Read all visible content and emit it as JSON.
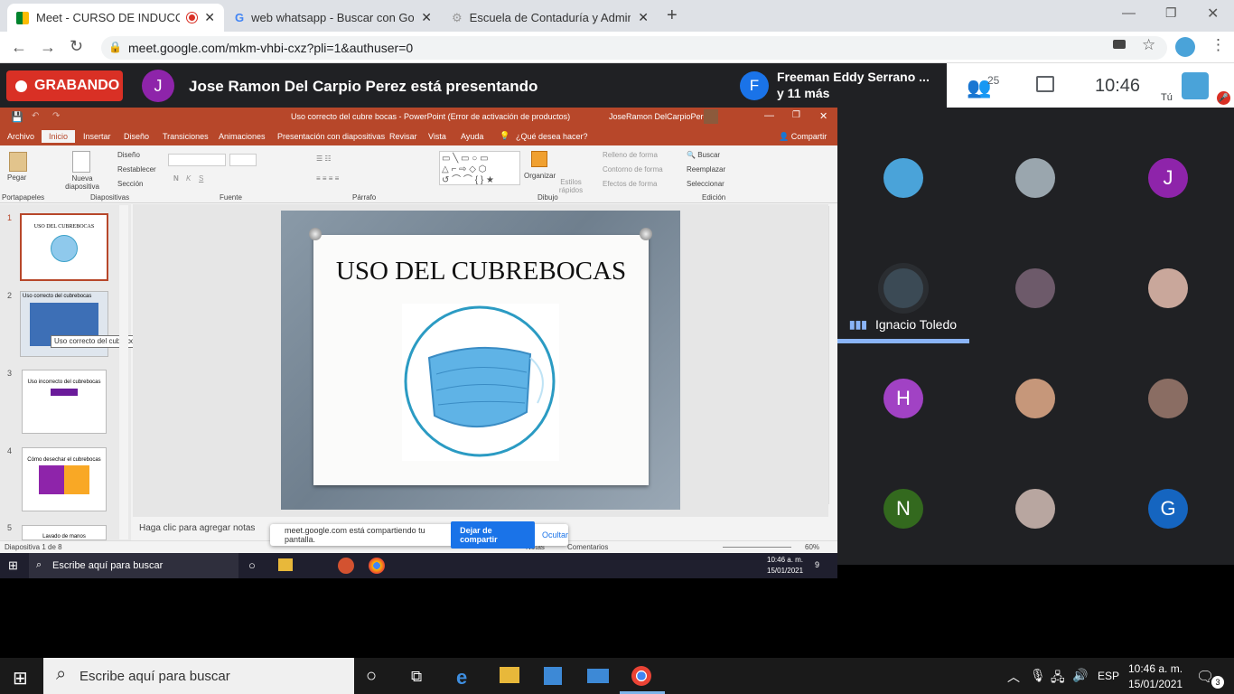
{
  "browser": {
    "tabs": [
      {
        "title": "Meet - CURSO DE INDUCCIÓ",
        "favicon": "meet-icon"
      },
      {
        "title": "web whatsapp - Buscar con Goo",
        "favicon": "google-icon"
      },
      {
        "title": "Escuela de Contaduría y Adminis",
        "favicon": "school-icon"
      }
    ],
    "url": "meet.google.com/mkm-vhbi-cxz?pli=1&authuser=0"
  },
  "meet": {
    "recording_label": "GRABANDO",
    "presenter_initial": "J",
    "presenter_text": "Jose Ramon Del Carpio Perez está presentando",
    "other_initial": "F",
    "other_line1": "Freeman Eddy Serrano ...",
    "other_line2": "y 11 más",
    "participant_count": "25",
    "time": "10:46",
    "self_label": "Tú",
    "speaking_name": "Ignacio Toledo",
    "tiles": [
      {
        "initial": "",
        "color": "#4aa3d9"
      },
      {
        "initial": "",
        "color": "#9aa6ae"
      },
      {
        "initial": "J",
        "color": "#8e24aa"
      },
      {
        "initial": "",
        "color": "#3b4a55"
      },
      {
        "initial": "",
        "color": "#6d5a6a"
      },
      {
        "initial": "",
        "color": "#c9a79b"
      },
      {
        "initial": "H",
        "color": "#a142c4"
      },
      {
        "initial": "",
        "color": "#c6977a"
      },
      {
        "initial": "",
        "color": "#8a6d63"
      },
      {
        "initial": "N",
        "color": "#33691e"
      },
      {
        "initial": "",
        "color": "#b8a6a0"
      },
      {
        "initial": "G",
        "color": "#1565c0"
      }
    ]
  },
  "ppt": {
    "title": "Uso correcto del cubre bocas  -  PowerPoint (Error de activación de productos)",
    "user": "JoseRamon DelCarpioPerez",
    "tabs": [
      "Archivo",
      "Inicio",
      "Insertar",
      "Diseño",
      "Transiciones",
      "Animaciones",
      "Presentación con diapositivas",
      "Revisar",
      "Vista",
      "Ayuda",
      "¿Qué desea hacer?"
    ],
    "share": "Compartir",
    "groups": [
      "Portapapeles",
      "Diapositivas",
      "Fuente",
      "Párrafo",
      "Dibujo",
      "Edición"
    ],
    "clip": {
      "paste": "Pegar"
    },
    "slides_group": {
      "new": "Nueva diapositiva",
      "layout": "Diseño",
      "reset": "Restablecer",
      "section": "Sección"
    },
    "drawing": {
      "arrange": "Organizar",
      "styles": "Estilos rápidos",
      "fill": "Relleno de forma",
      "outline": "Contorno de forma",
      "effects": "Efectos de forma"
    },
    "editing": {
      "find": "Buscar",
      "replace": "Reemplazar",
      "select": "Seleccionar"
    },
    "thumbs": [
      {
        "num": "1",
        "text": "USO DEL CUBREBOCAS"
      },
      {
        "num": "2",
        "text": "Uso correcto del cubrebocas"
      },
      {
        "num": "3",
        "text": "Uso incorrecto del cubrebocas"
      },
      {
        "num": "4",
        "text": "Cómo desechar el cubrebocas"
      },
      {
        "num": "5",
        "text": "Lavado de manos"
      }
    ],
    "tooltip": "Uso correcto del cubrebocas",
    "slide_title": "USO DEL CUBREBOCAS",
    "notes_placeholder": "Haga clic para agregar notas",
    "status_left": "Diapositiva 1 de 8",
    "notes_btn": "Notas",
    "comments_btn": "Comentarios",
    "zoom": "60%",
    "sharebar_text": "meet.google.com está compartiendo tu pantalla.",
    "stop_share": "Dejar de compartir",
    "hide": "Ocultar"
  },
  "inner_taskbar": {
    "search": "Escribe aquí para buscar",
    "time": "10:46 a. m.",
    "date": "15/01/2021",
    "notif": "9"
  },
  "taskbar": {
    "search": "Escribe aquí para buscar",
    "lang": "ESP",
    "time": "10:46 a. m.",
    "date": "15/01/2021",
    "notif": "3"
  }
}
